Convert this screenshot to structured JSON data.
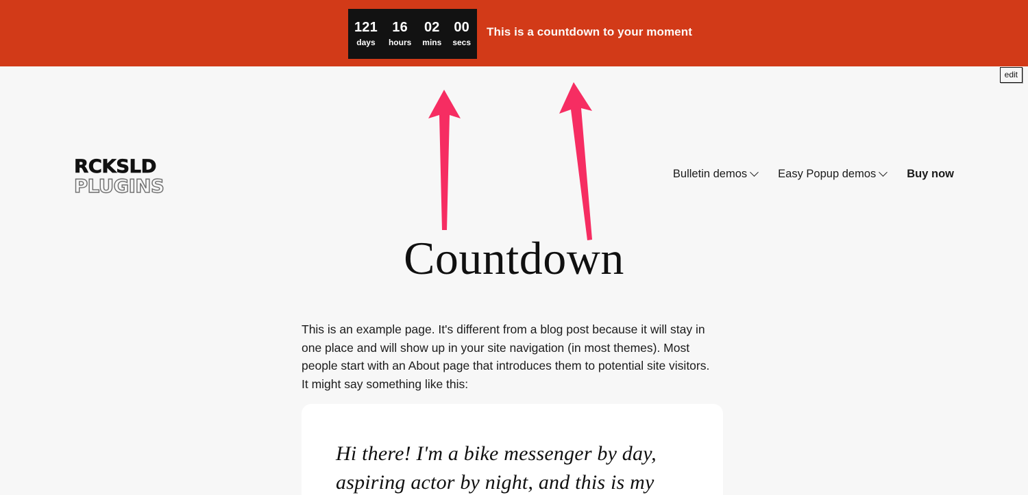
{
  "banner": {
    "background_color": "#d23a18",
    "box_color": "#121212",
    "message": "This is a countdown to your moment",
    "countdown": [
      {
        "value": "121",
        "label": "days"
      },
      {
        "value": "16",
        "label": "hours"
      },
      {
        "value": "02",
        "label": "mins"
      },
      {
        "value": "00",
        "label": "secs"
      }
    ]
  },
  "edit": {
    "label": "edit"
  },
  "header": {
    "logo": {
      "line1": "RCKSLD",
      "line2": "PLUGINS"
    },
    "nav": [
      {
        "label": "Bulletin demos",
        "has_chevron": true,
        "bold": false,
        "icon": "chevron-down-icon"
      },
      {
        "label": "Easy Popup demos",
        "has_chevron": true,
        "bold": false,
        "icon": "chevron-down-icon"
      },
      {
        "label": "Buy now",
        "has_chevron": false,
        "bold": true,
        "icon": ""
      }
    ]
  },
  "annotations": {
    "arrow_color": "#f62d62",
    "arrows": [
      {
        "name": "arrow-left",
        "description": "up arrow pointing at countdown bar"
      },
      {
        "name": "arrow-right",
        "description": "up arrow pointing at countdown bar"
      }
    ]
  },
  "main": {
    "title": "Countdown",
    "paragraph": "This is an example page. It's different from a blog post because it will stay in one place and will show up in your site navigation (in most themes). Most people start with an About page that introduces them to potential site visitors. It might say something like this:",
    "quote": "Hi there! I'm a bike messenger by day, aspiring actor by night, and this is my"
  },
  "colors": {
    "page_background": "#f7f7f7",
    "card_background": "#ffffff",
    "text": "#1b1b1b",
    "accent_orange": "#d23a18",
    "accent_pink": "#f62d62"
  }
}
